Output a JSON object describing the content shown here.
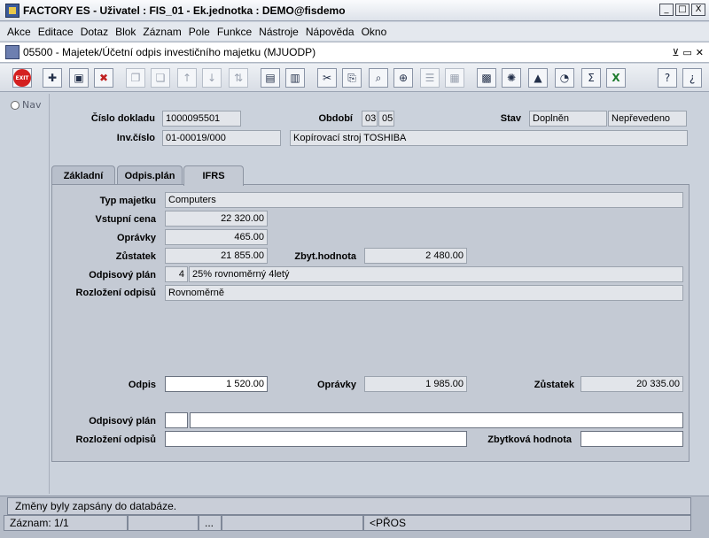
{
  "app": {
    "title": "FACTORY ES - Uživatel : FIS_01 - Ek.jednotka : DEMO@fisdemo",
    "window_buttons": [
      "_",
      "□",
      "X"
    ]
  },
  "menu": [
    "Akce",
    "Editace",
    "Dotaz",
    "Blok",
    "Záznam",
    "Pole",
    "Funkce",
    "Nástroje",
    "Nápověda",
    "Okno"
  ],
  "form": {
    "title": "05500 - Majetek/Účetní odpis investičního majetku (MJUODP)",
    "buttons": [
      "⊻",
      "▭",
      "✕"
    ]
  },
  "toolbar": {
    "exit_label": "EXIT",
    "icons": [
      "exit-icon",
      "insert-record-icon",
      "save-icon",
      "delete-record-icon",
      "copy-icon",
      "paste-icon",
      "sort-asc-icon",
      "sort-desc-icon",
      "sort-icon",
      "print-icon",
      "print-preview-icon",
      "cut-icon",
      "copy-record-icon",
      "find-icon",
      "zoom-icon",
      "list-icon",
      "grid-icon",
      "calculator-icon",
      "wheel-icon",
      "triangle-icon",
      "gauge-icon",
      "sum-icon",
      "excel-icon",
      "help-icon",
      "context-help-icon"
    ]
  },
  "nav": {
    "label": "Nav"
  },
  "header": {
    "cislo_dokladu_label": "Číslo dokladu",
    "cislo_dokladu": "1000095501",
    "obdobi_label": "Období",
    "obdobi_month": "03",
    "obdobi_year": "05",
    "stav_label": "Stav",
    "stav_1": "Doplněn",
    "stav_2": "Nepřevedeno",
    "inv_cislo_label": "Inv.číslo",
    "inv_cislo": "01-00019/000",
    "inv_popis": "Kopírovací stroj TOSHIBA"
  },
  "tabs": [
    "Základní",
    "Odpis.plán",
    "IFRS"
  ],
  "active_tab": "IFRS",
  "ifrs": {
    "typ_majetku_label": "Typ majetku",
    "typ_majetku": "Computers",
    "vstupni_cena_label": "Vstupní cena",
    "vstupni_cena": "22 320.00",
    "opravky_label": "Oprávky",
    "opravky": "465.00",
    "zustatek_label": "Zůstatek",
    "zustatek": "21 855.00",
    "zbyt_hodnota_label": "Zbyt.hodnota",
    "zbyt_hodnota": "2 480.00",
    "odpisovy_plan_label": "Odpisový plán",
    "odpisovy_plan_code": "4",
    "odpisovy_plan": "25% rovnoměrný 4letý",
    "rozlozeni_label": "Rozložení odpisů",
    "rozlozeni": "Rovnoměrně",
    "odpis_label": "Odpis",
    "odpis": "1 520.00",
    "opravky2_label": "Oprávky",
    "opravky2": "1 985.00",
    "zustatek2_label": "Zůstatek",
    "zustatek2": "20 335.00",
    "odpisovy_plan2_label": "Odpisový plán",
    "odpisovy_plan2_code": "",
    "odpisovy_plan2": "",
    "rozlozeni2_label": "Rozložení odpisů",
    "rozlozeni2": "",
    "zbytkova_label": "Zbytková hodnota",
    "zbytkova": ""
  },
  "status": {
    "message": "Změny byly zapsány do databáze.",
    "record": "Záznam: 1/1",
    "cell2": "",
    "cell3": "...",
    "cell4": "",
    "mode": "<PŘOS"
  }
}
